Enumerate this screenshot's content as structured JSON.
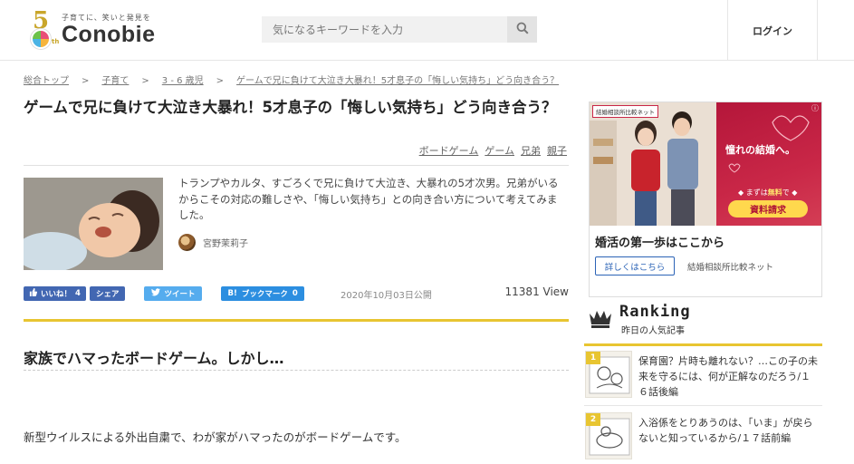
{
  "header": {
    "logo_tagline": "子育てに、笑いと発見を",
    "logo_word": "Conobie",
    "logo_badge_num": "5",
    "logo_badge_suffix": "th",
    "search_placeholder": "気になるキーワードを入力",
    "login_label": "ログイン"
  },
  "breadcrumb": [
    "総合トップ",
    "子育て",
    "3 - 6 歳児",
    "ゲームで兄に負けて大泣き大暴れ！5才息子の「悔しい気持ち」どう向き合う？"
  ],
  "breadcrumb_sep": ">",
  "article": {
    "title": "ゲームで兄に負けて大泣き大暴れ！5才息子の「悔しい気持ち」どう向き合う？",
    "tags": [
      "ボードゲーム",
      "ゲーム",
      "兄弟",
      "親子"
    ],
    "lead": "トランプやカルタ、すごろくで兄に負けて大泣き、大暴れの5才次男。兄弟がいるからこその対応の難しさや、「悔しい気持ち」との向き合い方について考えてみました。",
    "author": "宮野茉莉子",
    "share": {
      "like_label": "いいね！",
      "like_count": "4",
      "share_label": "シェア",
      "tweet_label": "ツイート",
      "hatena_mark": "B!",
      "bookmark_label": "ブックマーク",
      "bookmark_count": "0"
    },
    "published": "2020年10月03日公開",
    "views": "11381 View",
    "section_heading": "家族でハマったボードゲーム。しかし…",
    "body_first": "新型ウイルスによる外出自粛で、わが家がハマったのがボードゲームです。"
  },
  "ad": {
    "badge": "結婚相談所比較ネット",
    "catch": "憧れの結婚へ。",
    "free_prefix": "まずは",
    "free_strong": "無料",
    "free_suffix": "で",
    "cta": "資料請求",
    "headline": "婚活の第一歩はここから",
    "detail_button": "詳しくはこちら",
    "sponsor": "結婚相談所比較ネット"
  },
  "ranking": {
    "title": "Ranking",
    "subtitle": "昨日の人気記事",
    "items": [
      {
        "rank": "1",
        "text": "保育園？片時も離れない？…この子の未来を守るには、何が正解なのだろう/１６話後編"
      },
      {
        "rank": "2",
        "text": "入浴係をとりあうのは、「いま」が戻らないと知っているから/１７話前編"
      }
    ]
  },
  "colors": {
    "accent_gold": "#e8c531",
    "facebook": "#4267b2",
    "twitter": "#55acee",
    "hatena": "#2c8ee0",
    "ad_pink": "#c92747"
  }
}
